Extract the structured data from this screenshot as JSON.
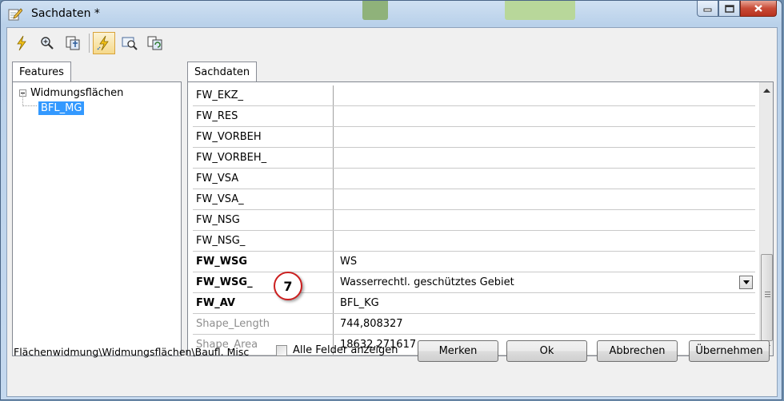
{
  "window": {
    "title": "Sachdaten *",
    "controls": [
      "minimize",
      "maximize",
      "close"
    ]
  },
  "toolbar": {
    "tools": [
      {
        "name": "flash-icon"
      },
      {
        "name": "zoom-to-icon"
      },
      {
        "name": "pan-to-icon"
      },
      {
        "name": "identify-flash-icon",
        "active": true
      },
      {
        "name": "select-feature-icon"
      },
      {
        "name": "refresh-icon"
      }
    ]
  },
  "features": {
    "tab_label": "Features",
    "tree": {
      "parent": "Widmungsflächen",
      "child": "BFL_MG"
    }
  },
  "sachdaten": {
    "tab_label": "Sachdaten",
    "rows": [
      {
        "field": "FW_EKZ_",
        "value": "",
        "style": "normal"
      },
      {
        "field": "FW_RES",
        "value": "",
        "style": "normal"
      },
      {
        "field": "FW_VORBEH",
        "value": "",
        "style": "normal"
      },
      {
        "field": "FW_VORBEH_",
        "value": "",
        "style": "normal"
      },
      {
        "field": "FW_VSA",
        "value": "",
        "style": "normal"
      },
      {
        "field": "FW_VSA_",
        "value": "",
        "style": "normal"
      },
      {
        "field": "FW_NSG",
        "value": "",
        "style": "normal"
      },
      {
        "field": "FW_NSG_",
        "value": "",
        "style": "normal"
      },
      {
        "field": "FW_WSG",
        "value": "WS",
        "style": "bold"
      },
      {
        "field": "FW_WSG_",
        "value": "Wasserrechtl. geschütztes Gebiet",
        "style": "bold",
        "dropdown": true
      },
      {
        "field": "FW_AV",
        "value": "BFL_KG",
        "style": "bold"
      },
      {
        "field": "Shape_Length",
        "value": "744,808327",
        "style": "grey"
      },
      {
        "field": "Shape_Area",
        "value": "18632,271617",
        "style": "grey"
      }
    ]
  },
  "callout": {
    "number": "7",
    "color": "#cc1f1f"
  },
  "footer": {
    "path": "Flächenwidmung\\Widmungsflächen\\Baufl. Misc",
    "checkbox_label": "Alle Felder anzeigen",
    "checkbox_checked": false,
    "buttons": {
      "merken": "Merken",
      "ok": "Ok",
      "abbrechen": "Abbrechen",
      "uebernehmen": "Übernehmen"
    }
  },
  "colors": {
    "selection": "#3399ff",
    "title_gradient": "#b9d1ea",
    "close_button": "#c84a36"
  }
}
